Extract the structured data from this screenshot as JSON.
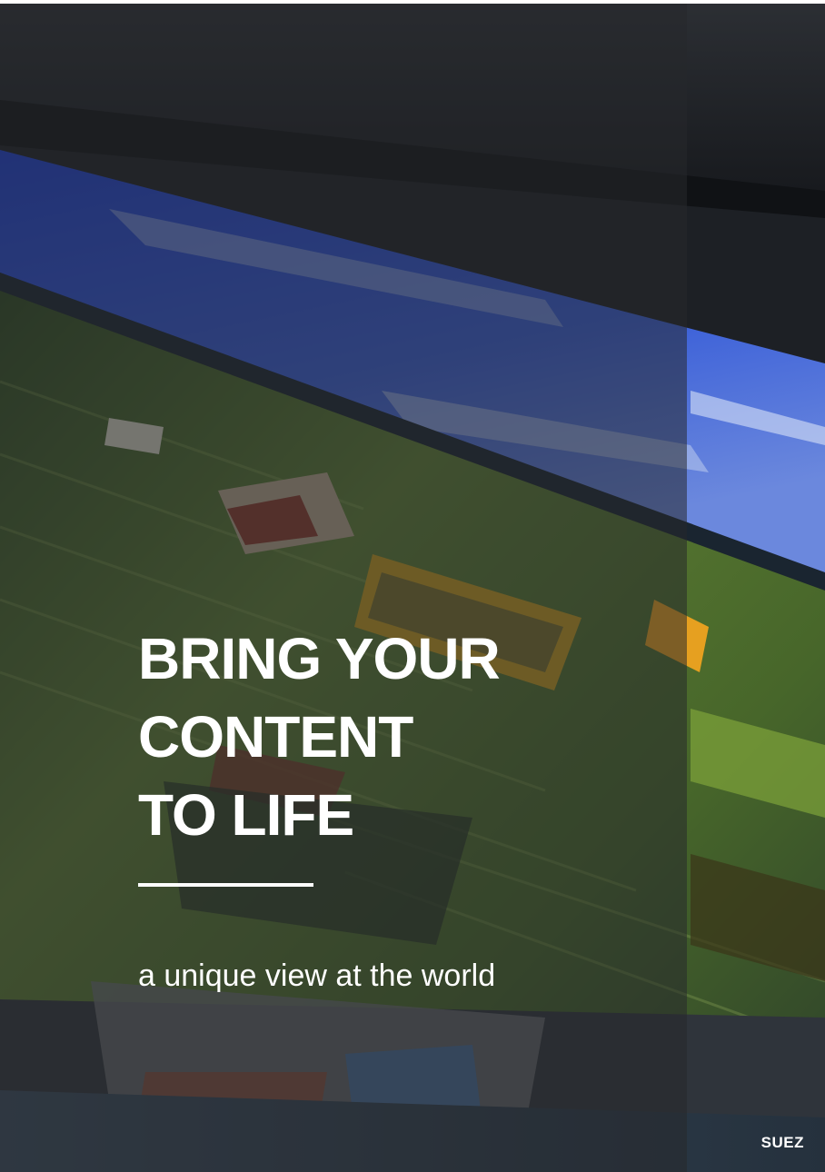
{
  "headline": {
    "line1": "BRING YOUR",
    "line2": "CONTENT",
    "line3": "TO LIFE"
  },
  "tagline": "a unique view at the world",
  "brand": "SUEZ",
  "colors": {
    "text": "#ffffff",
    "panel_overlay": "rgba(38,40,44,0.55)",
    "sky": "#2b48c8",
    "landscape": "#4d6a2c"
  }
}
